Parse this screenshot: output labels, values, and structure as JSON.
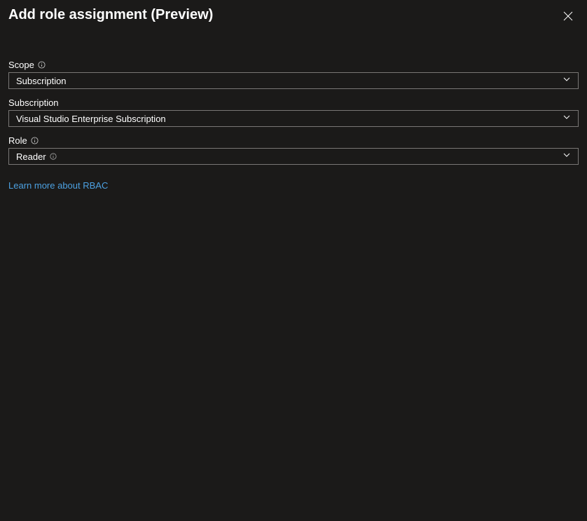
{
  "header": {
    "title": "Add role assignment (Preview)"
  },
  "fields": {
    "scope": {
      "label": "Scope",
      "value": "Subscription"
    },
    "subscription": {
      "label": "Subscription",
      "value": "Visual Studio Enterprise Subscription"
    },
    "role": {
      "label": "Role",
      "value": "Reader"
    }
  },
  "link": {
    "text": "Learn more about RBAC"
  }
}
